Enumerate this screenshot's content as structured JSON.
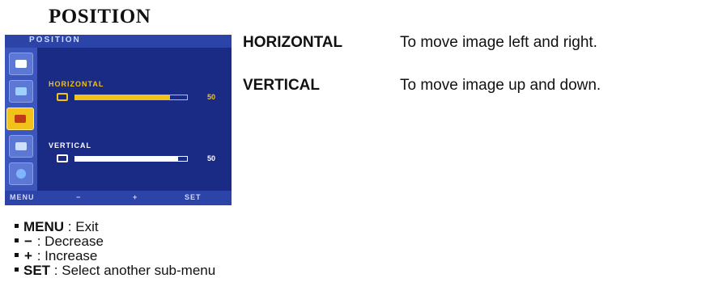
{
  "page_title": "POSITION",
  "osd": {
    "header_title": "POSITION",
    "sidebar_icons": [
      "picture-icon",
      "color-icon",
      "position-icon",
      "tracking-icon",
      "setup-icon"
    ],
    "active_index": 2,
    "horizontal": {
      "label": "HORIZONTAL",
      "value": "50",
      "level": 0.85,
      "label_color": "#f2c21a",
      "fill_color": "#f2c21a"
    },
    "vertical": {
      "label": "VERTICAL",
      "value": "50",
      "level": 0.92,
      "label_color": "#ffffff",
      "fill_color": "#ffffff"
    },
    "footer": {
      "menu": "MENU",
      "minus": "−",
      "plus": "+",
      "set": "SET"
    }
  },
  "descriptions": [
    {
      "term": "HORIZONTAL",
      "definition": "To move image left and right."
    },
    {
      "term": "VERTICAL",
      "definition": "To move image up and down."
    }
  ],
  "legend": [
    {
      "key": "MENU",
      "text": " : Exit"
    },
    {
      "key": "−",
      "text": " : Decrease"
    },
    {
      "key": "+",
      "text": " : Increase"
    },
    {
      "key": "SET",
      "text": " : Select another sub-menu"
    }
  ],
  "colors": {
    "osd_bg": "#1c2f8c",
    "accent": "#f2c21a"
  }
}
